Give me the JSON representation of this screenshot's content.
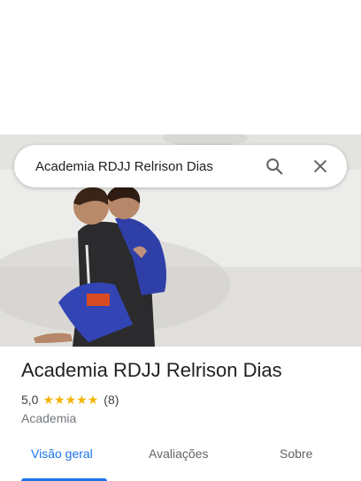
{
  "search": {
    "query": "Academia RDJJ Relrison Dias",
    "search_icon": "search-icon",
    "close_icon": "close-icon"
  },
  "place": {
    "name": "Academia RDJJ Relrison Dias",
    "rating": "5,0",
    "stars": [
      "★",
      "★",
      "★",
      "★",
      "★"
    ],
    "review_count": "(8)",
    "category": "Academia"
  },
  "tabs": [
    {
      "label": "Visão geral",
      "active": true
    },
    {
      "label": "Avaliações",
      "active": false
    },
    {
      "label": "Sobre",
      "active": false
    }
  ],
  "colors": {
    "accent": "#1a73e8",
    "star": "#f4b400",
    "text_primary": "#202124",
    "text_secondary": "#70757a"
  }
}
